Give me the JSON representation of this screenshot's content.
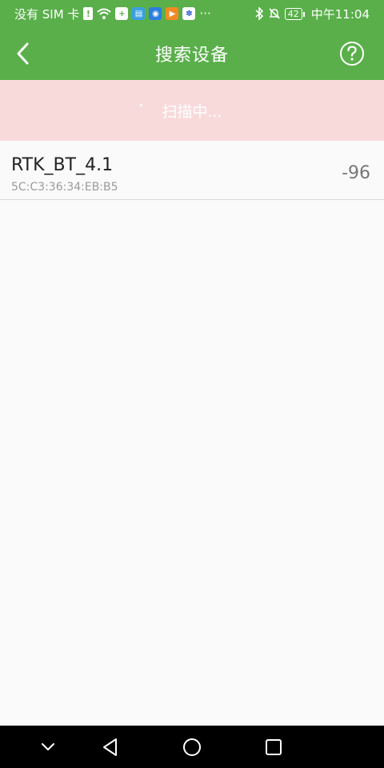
{
  "status_bar": {
    "carrier": "没有 SIM 卡",
    "more": "···",
    "battery": "42",
    "time": "中午11:04"
  },
  "app_bar": {
    "title": "搜索设备",
    "back_icon": "chevron-left-icon",
    "help_icon": "question-circle-icon"
  },
  "scan_banner": {
    "text": "扫描中...",
    "color": "#f9dadb"
  },
  "devices": [
    {
      "name": "RTK_BT_4.1",
      "mac": "5C:C3:36:34:EB:B5",
      "rssi": "-96"
    }
  ],
  "colors": {
    "primary": "#5aaf4b",
    "background": "#fafafa"
  },
  "nav_bar": {
    "buttons": [
      "collapse-icon",
      "back-triangle-icon",
      "home-circle-icon",
      "recents-square-icon"
    ]
  }
}
